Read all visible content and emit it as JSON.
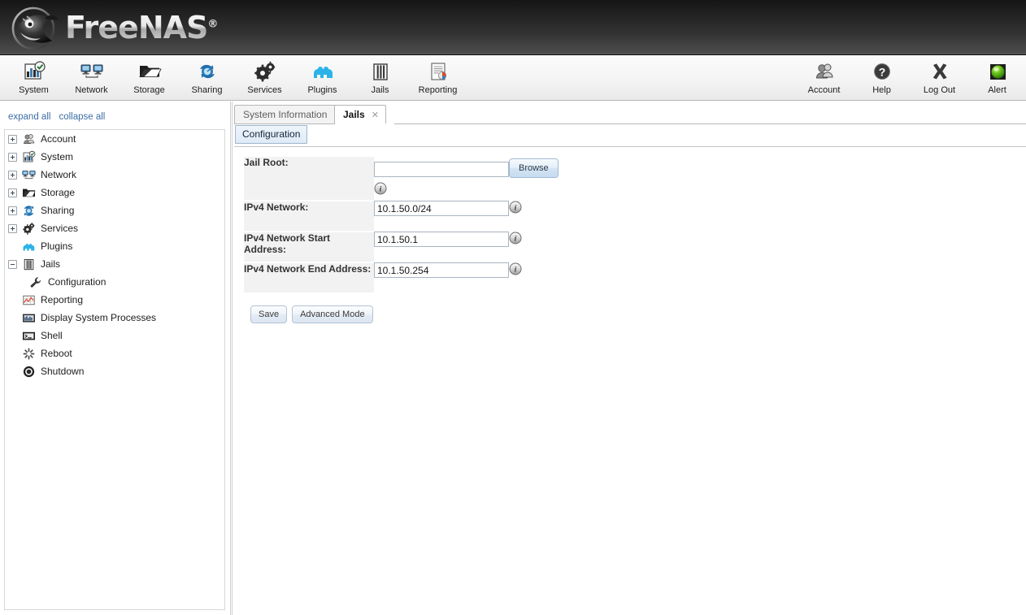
{
  "header": {
    "product_name": "FreeNAS",
    "registered_mark": "®",
    "logo_icon": "freenas-fish-logo"
  },
  "toolbar": {
    "left_items": [
      {
        "label": "System",
        "icon": "system-chart-icon"
      },
      {
        "label": "Network",
        "icon": "network-monitors-icon"
      },
      {
        "label": "Storage",
        "icon": "storage-folder-icon"
      },
      {
        "label": "Sharing",
        "icon": "sharing-refresh-icon"
      },
      {
        "label": "Services",
        "icon": "services-gears-icon"
      },
      {
        "label": "Plugins",
        "icon": "plugins-puzzle-icon"
      },
      {
        "label": "Jails",
        "icon": "jails-bars-icon"
      },
      {
        "label": "Reporting",
        "icon": "reporting-report-icon"
      }
    ],
    "right_items": [
      {
        "label": "Account",
        "icon": "account-users-icon"
      },
      {
        "label": "Help",
        "icon": "help-question-icon"
      },
      {
        "label": "Log Out",
        "icon": "logout-x-icon"
      },
      {
        "label": "Alert",
        "icon": "alert-green-light-icon"
      }
    ]
  },
  "sidebar": {
    "expand_all_label": "expand all",
    "collapse_all_label": "collapse all",
    "items": [
      {
        "label": "Account",
        "icon": "account-users-icon",
        "toggle": "plus",
        "depth": 0
      },
      {
        "label": "System",
        "icon": "system-chart-icon",
        "toggle": "plus",
        "depth": 0
      },
      {
        "label": "Network",
        "icon": "network-monitors-icon",
        "toggle": "plus",
        "depth": 0
      },
      {
        "label": "Storage",
        "icon": "storage-folder-icon",
        "toggle": "plus",
        "depth": 0
      },
      {
        "label": "Sharing",
        "icon": "sharing-refresh-icon",
        "toggle": "plus",
        "depth": 0
      },
      {
        "label": "Services",
        "icon": "services-gears-icon",
        "toggle": "plus",
        "depth": 0
      },
      {
        "label": "Plugins",
        "icon": "plugins-puzzle-icon",
        "toggle": "none",
        "depth": 0
      },
      {
        "label": "Jails",
        "icon": "jails-bars-icon",
        "toggle": "minus",
        "depth": 0
      },
      {
        "label": "Configuration",
        "icon": "wrench-icon",
        "toggle": "none",
        "depth": 1
      },
      {
        "label": "Reporting",
        "icon": "reporting-graph-icon",
        "toggle": "none",
        "depth": 0
      },
      {
        "label": "Display System Processes",
        "icon": "processes-icon",
        "toggle": "none",
        "depth": 0
      },
      {
        "label": "Shell",
        "icon": "shell-terminal-icon",
        "toggle": "none",
        "depth": 0
      },
      {
        "label": "Reboot",
        "icon": "reboot-spinner-icon",
        "toggle": "none",
        "depth": 0
      },
      {
        "label": "Shutdown",
        "icon": "shutdown-power-icon",
        "toggle": "none",
        "depth": 0
      }
    ]
  },
  "tabs": [
    {
      "label": "System Information",
      "active": false,
      "close": "✕"
    },
    {
      "label": "Jails",
      "active": true,
      "close": "✕"
    }
  ],
  "subtab": {
    "label": "Configuration"
  },
  "form": {
    "rows": [
      {
        "label": "Jail Root:",
        "value": "",
        "placeholder": "",
        "info_icon": "info-icon"
      },
      {
        "label": "IPv4 Network:",
        "value": "10.1.50.0/24",
        "placeholder": "",
        "info_icon": "info-icon"
      },
      {
        "label": "IPv4 Network Start Address:",
        "value": "10.1.50.1",
        "placeholder": "",
        "info_icon": "info-icon"
      },
      {
        "label": "IPv4 Network End Address:",
        "value": "10.1.50.254",
        "placeholder": "",
        "info_icon": "info-icon"
      }
    ],
    "browse_label": "Browse",
    "save_label": "Save",
    "advanced_mode_label": "Advanced Mode"
  },
  "colors": {
    "header_dark": "#1e1e1e",
    "accent_blue": "#3d6ea5",
    "label_bg": "#f2f2f2",
    "input_border": "#a9b4c0",
    "alert_green": "#5cc11a"
  }
}
